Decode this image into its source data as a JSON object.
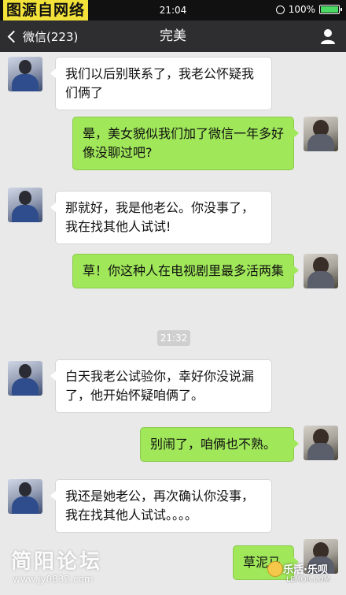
{
  "watermark": {
    "top_text": "图源自网络",
    "bottom_text": "简阳论坛",
    "bottom_url": "www.jy0832.com",
    "logo_text": "乐活·乐呗",
    "logo_url": "LEMOR.COM"
  },
  "status_bar": {
    "time": "21:04",
    "battery": "100%"
  },
  "nav": {
    "back_label": "微信(223)",
    "title": "完美"
  },
  "messages": [
    {
      "side": "in",
      "text": "我们以后别联系了，我老公怀疑我们俩了"
    },
    {
      "side": "out",
      "text": "晕，美女貌似我们加了微信一年多好像没聊过吧?"
    },
    {
      "side": "in",
      "text": "那就好，我是他老公。你没事了，我在找其他人试试!"
    },
    {
      "side": "out",
      "text": "草！你这种人在电视剧里最多活两集"
    },
    {
      "side": "in",
      "text": "白天我老公试验你，幸好你没说漏了，他开始怀疑咱俩了。"
    },
    {
      "side": "out",
      "text": "别闹了，咱俩也不熟。"
    },
    {
      "side": "in",
      "text": "我还是她老公，再次确认你没事，我在找其他人试试。。。。"
    },
    {
      "side": "out",
      "text": "草泥马"
    }
  ],
  "timestamp": "21:32",
  "colors": {
    "nav_bg": "#2e2e31",
    "chat_bg": "#e9e9e9",
    "bubble_out": "#a0e75a",
    "bubble_in": "#ffffff"
  },
  "icons": {
    "back": "chevron-left-icon",
    "profile": "person-icon",
    "lock": "rotation-lock-icon",
    "battery": "battery-icon"
  }
}
